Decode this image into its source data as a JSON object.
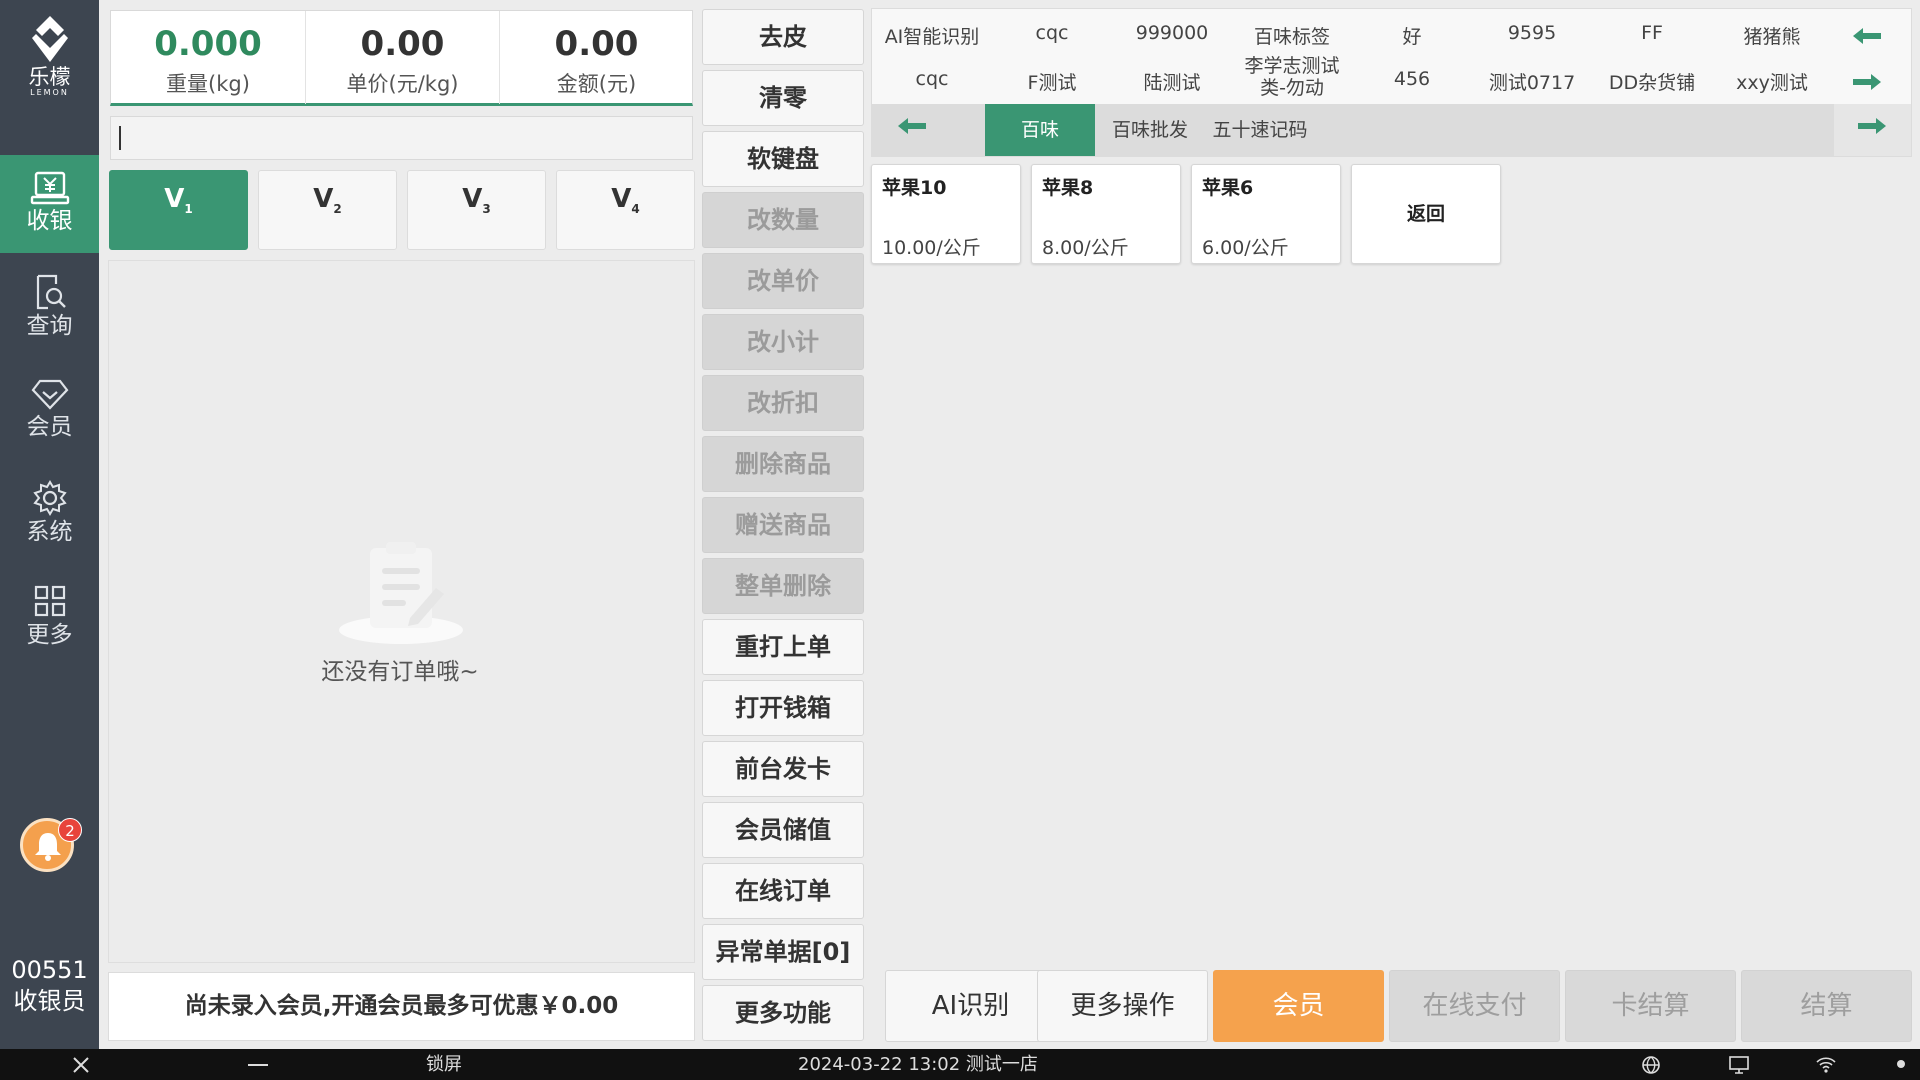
{
  "brand": {
    "name_cn": "乐檬",
    "name_en": "LEMON"
  },
  "sidebar": {
    "items": [
      {
        "label": "收银",
        "icon": "cash-register-icon",
        "active": true
      },
      {
        "label": "查询",
        "icon": "search-doc-icon",
        "active": false
      },
      {
        "label": "会员",
        "icon": "diamond-icon",
        "active": false
      },
      {
        "label": "系统",
        "icon": "gear-icon",
        "active": false
      },
      {
        "label": "更多",
        "icon": "grid-icon",
        "active": false
      }
    ],
    "notification_count": "2",
    "cashier_id": "00551",
    "cashier_role": "收银员"
  },
  "scale": {
    "weight": "0.000",
    "weight_label": "重量(kg)",
    "unit_price": "0.00",
    "unit_price_label": "单价(元/kg)",
    "amount": "0.00",
    "amount_label": "金额(元)"
  },
  "code_input": {
    "value": ""
  },
  "vtabs": [
    {
      "label": "V",
      "sub": "1",
      "active": true
    },
    {
      "label": "V",
      "sub": "2",
      "active": false
    },
    {
      "label": "V",
      "sub": "3",
      "active": false
    },
    {
      "label": "V",
      "sub": "4",
      "active": false
    }
  ],
  "order": {
    "empty_text": "还没有订单哦~"
  },
  "member_banner": "尚未录入会员,开通会员最多可优惠￥0.00",
  "functions": [
    {
      "label": "去皮",
      "enabled": true
    },
    {
      "label": "清零",
      "enabled": true
    },
    {
      "label": "软键盘",
      "enabled": true
    },
    {
      "label": "改数量",
      "enabled": false
    },
    {
      "label": "改单价",
      "enabled": false
    },
    {
      "label": "改小计",
      "enabled": false
    },
    {
      "label": "改折扣",
      "enabled": false
    },
    {
      "label": "删除商品",
      "enabled": false
    },
    {
      "label": "赠送商品",
      "enabled": false
    },
    {
      "label": "整单删除",
      "enabled": false
    },
    {
      "label": "重打上单",
      "enabled": true
    },
    {
      "label": "打开钱箱",
      "enabled": true
    },
    {
      "label": "前台发卡",
      "enabled": true
    },
    {
      "label": "会员储值",
      "enabled": true
    },
    {
      "label": "在线订单",
      "enabled": true
    },
    {
      "label": "异常单据[0]",
      "enabled": true
    },
    {
      "label": "更多功能",
      "enabled": true
    }
  ],
  "categories": {
    "row1": [
      "AI智能识别",
      "cqc",
      "999000",
      "百味标签",
      "好",
      "9595",
      "FF",
      "猪猪熊"
    ],
    "row2": [
      "cqc",
      "F测试",
      "陆测试",
      "李学志测试类-勿动",
      "456",
      "测试0717",
      "DD杂货铺",
      "xxy测试"
    ],
    "subcategories": [
      {
        "label": "百味",
        "active": true
      },
      {
        "label": "百味批发",
        "active": false
      },
      {
        "label": "五十速记码",
        "active": false
      }
    ]
  },
  "products": [
    {
      "name": "苹果10",
      "price": "10.00/公斤"
    },
    {
      "name": "苹果8",
      "price": "8.00/公斤"
    },
    {
      "name": "苹果6",
      "price": "6.00/公斤"
    }
  ],
  "back_label": "返回",
  "actions": [
    {
      "label": "AI识别",
      "style": "normal"
    },
    {
      "label": "更多操作",
      "style": "normal"
    },
    {
      "label": "会员",
      "style": "orange"
    },
    {
      "label": "在线支付",
      "style": "disabled"
    },
    {
      "label": "卡结算",
      "style": "disabled"
    },
    {
      "label": "结算",
      "style": "disabled"
    }
  ],
  "taskbar": {
    "lock_label": "锁屏",
    "datetime_store": "2024-03-22 13:02 测试一店"
  },
  "colors": {
    "primary": "#3a9673",
    "accent": "#f5a24d",
    "sidebar": "#3d4550"
  }
}
